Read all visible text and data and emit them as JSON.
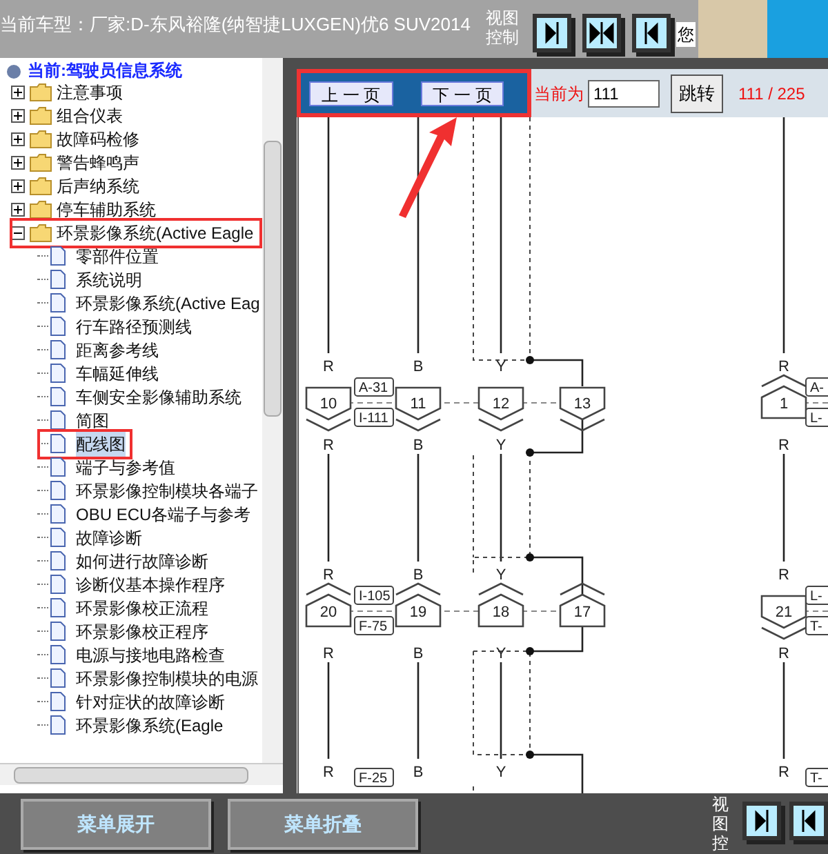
{
  "header": {
    "title": "当前车型：厂家:D-东风裕隆(纳智捷LUXGEN)优6 SUV2014",
    "view_label": [
      "视图",
      "控制"
    ],
    "view_buttons": [
      {
        "kind": "right"
      },
      {
        "kind": "both"
      },
      {
        "kind": "left"
      }
    ],
    "greeting": "您"
  },
  "tree": {
    "title": "当前:驾驶员信息系统",
    "items": [
      {
        "label": "注意事项",
        "expanded": false,
        "highlighted": false
      },
      {
        "label": "组合仪表",
        "expanded": false,
        "highlighted": false
      },
      {
        "label": "故障码检修",
        "expanded": false,
        "highlighted": false
      },
      {
        "label": "警告蜂鸣声",
        "expanded": false,
        "highlighted": false
      },
      {
        "label": "后声纳系统",
        "expanded": false,
        "highlighted": false
      },
      {
        "label": "停车辅助系统",
        "expanded": false,
        "highlighted": false
      },
      {
        "label": "环景影像系统(Active Eagle",
        "expanded": true,
        "highlighted": true,
        "children": [
          {
            "label": "零部件位置",
            "selected": false,
            "highlighted": false
          },
          {
            "label": "系统说明",
            "selected": false,
            "highlighted": false
          },
          {
            "label": "环景影像系统(Active Eag",
            "selected": false,
            "highlighted": false
          },
          {
            "label": "行车路径预测线",
            "selected": false,
            "highlighted": false
          },
          {
            "label": "距离参考线",
            "selected": false,
            "highlighted": false
          },
          {
            "label": "车幅延伸线",
            "selected": false,
            "highlighted": false
          },
          {
            "label": "车侧安全影像辅助系统",
            "selected": false,
            "highlighted": false
          },
          {
            "label": "简图",
            "selected": false,
            "highlighted": false
          },
          {
            "label": "配线图",
            "selected": true,
            "highlighted": true
          },
          {
            "label": "端子与参考值",
            "selected": false,
            "highlighted": false
          },
          {
            "label": "环景影像控制模块各端子",
            "selected": false,
            "highlighted": false
          },
          {
            "label": "OBU ECU各端子与参考",
            "selected": false,
            "highlighted": false
          },
          {
            "label": "故障诊断",
            "selected": false,
            "highlighted": false
          },
          {
            "label": "如何进行故障诊断",
            "selected": false,
            "highlighted": false
          },
          {
            "label": "诊断仪基本操作程序",
            "selected": false,
            "highlighted": false
          },
          {
            "label": "环景影像校正流程",
            "selected": false,
            "highlighted": false
          },
          {
            "label": "环景影像校正程序",
            "selected": false,
            "highlighted": false
          },
          {
            "label": "电源与接地电路检查",
            "selected": false,
            "highlighted": false
          },
          {
            "label": "环景影像控制模块的电源",
            "selected": false,
            "highlighted": false
          },
          {
            "label": "针对症状的故障诊断",
            "selected": false,
            "highlighted": false
          },
          {
            "label": "环景影像系统(Eagle",
            "selected": false,
            "highlighted": false
          }
        ]
      }
    ]
  },
  "nav": {
    "prev": "上 一 页",
    "next": "下 一 页",
    "highlighted": true,
    "current_label": "当前为",
    "page_input": "111",
    "jump": "跳转",
    "page_count": "111 / 225"
  },
  "diagram": {
    "rows": [
      {
        "connectors": [
          {
            "number": "10",
            "kind": "down",
            "wire_top": "R",
            "wire_bottom": "R"
          },
          {
            "number": "11",
            "kind": "down",
            "wire_top": "B",
            "wire_bottom": "B"
          },
          {
            "number": "12",
            "kind": "down",
            "wire_top": "Y",
            "wire_bottom": "Y"
          },
          {
            "number": "13",
            "kind": "down"
          }
        ],
        "tags": [
          "A-31",
          "I-111"
        ],
        "right": {
          "number": "1",
          "kind": "up",
          "wire_top": "R",
          "wire_bottom": "R",
          "tags": [
            "A-",
            "L-"
          ]
        }
      },
      {
        "connectors": [
          {
            "number": "20",
            "kind": "up",
            "wire_top": "R",
            "wire_bottom": "R"
          },
          {
            "number": "19",
            "kind": "up",
            "wire_top": "B",
            "wire_bottom": "B"
          },
          {
            "number": "18",
            "kind": "up",
            "wire_top": "Y",
            "wire_bottom": "Y"
          },
          {
            "number": "17",
            "kind": "up"
          }
        ],
        "tags": [
          "I-105",
          "F-75"
        ],
        "right": {
          "number": "21",
          "kind": "down",
          "wire_top": "R",
          "wire_bottom": "R",
          "tags": [
            "L-",
            "T-"
          ]
        }
      },
      {
        "wires": [
          "R",
          "B",
          "Y"
        ],
        "tag": "F-25",
        "right": {
          "wire": "R",
          "tag": "T-"
        }
      }
    ]
  },
  "footer": {
    "expand": "菜单展开",
    "collapse": "菜单折叠",
    "view_label": [
      "视",
      "图",
      "控"
    ],
    "view_buttons": [
      {
        "kind": "right"
      },
      {
        "kind": "left"
      }
    ]
  }
}
